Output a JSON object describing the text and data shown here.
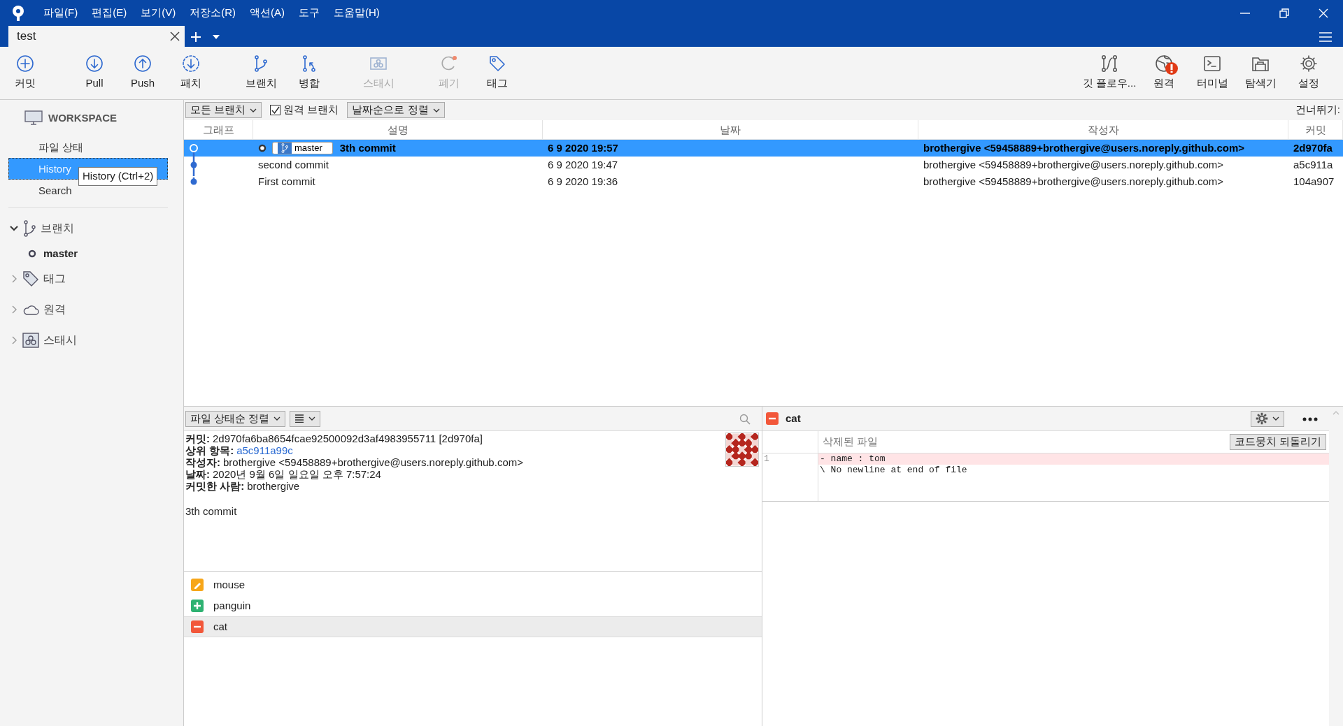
{
  "menu": [
    "파일(F)",
    "편집(E)",
    "보기(V)",
    "저장소(R)",
    "액션(A)",
    "도구",
    "도움말(H)"
  ],
  "tabs": [
    {
      "label": "test",
      "selected": true
    }
  ],
  "toolbar": {
    "left": [
      {
        "label": "커밋",
        "disabled": false
      },
      {
        "label": "Pull",
        "disabled": false
      },
      {
        "label": "Push",
        "disabled": false
      },
      {
        "label": "패치",
        "disabled": false
      },
      {
        "label": "브랜치",
        "disabled": false
      },
      {
        "label": "병합",
        "disabled": false
      },
      {
        "label": "스태시",
        "disabled": true
      },
      {
        "label": "폐기",
        "disabled": true
      },
      {
        "label": "태그",
        "disabled": false
      }
    ],
    "right": [
      {
        "label": "깃 플로우...",
        "alert": false
      },
      {
        "label": "원격",
        "alert": true
      },
      {
        "label": "터미널",
        "alert": false
      },
      {
        "label": "탐색기",
        "alert": false
      },
      {
        "label": "설정",
        "alert": false
      }
    ]
  },
  "sidebar": {
    "workspace": {
      "title": "WORKSPACE",
      "items": [
        {
          "label": "파일 상태",
          "selected": false
        },
        {
          "label": "History",
          "selected": true
        },
        {
          "label": "Search",
          "selected": false
        }
      ]
    },
    "tooltip": "History (Ctrl+2)",
    "groups": [
      {
        "label": "브랜치",
        "expanded": true,
        "children": [
          {
            "label": "master",
            "current": true
          }
        ]
      },
      {
        "label": "태그",
        "expanded": false
      },
      {
        "label": "원격",
        "expanded": false
      },
      {
        "label": "스태시",
        "expanded": false
      }
    ]
  },
  "filter_bar": {
    "branch_filter": "모든 브랜치",
    "remote_branches": {
      "label": "원격 브랜치",
      "checked": true
    },
    "sort": "날짜순으로 정렬",
    "jump_label": "건너뛰기:"
  },
  "commits": {
    "columns": [
      "그래프",
      "설명",
      "날짜",
      "작성자",
      "커밋"
    ],
    "rows": [
      {
        "description": "3th commit",
        "branch": "master",
        "date": "6 9 2020 19:57",
        "author": "brothergive <59458889+brothergive@users.noreply.github.com>",
        "commit": "2d970fa",
        "selected": true,
        "head": true
      },
      {
        "description": "second commit",
        "date": "6 9 2020 19:47",
        "author": "brothergive <59458889+brothergive@users.noreply.github.com>",
        "commit": "a5c911a",
        "selected": false,
        "head": false
      },
      {
        "description": "First commit",
        "date": "6 9 2020 19:36",
        "author": "brothergive <59458889+brothergive@users.noreply.github.com>",
        "commit": "104a907",
        "selected": false,
        "head": false
      }
    ]
  },
  "details": {
    "sort": "파일 상태순 정렬",
    "fields": [
      {
        "label": "커밋:",
        "value": "2d970fa6ba8654fcae92500092d3af4983955711 [2d970fa]",
        "link": false
      },
      {
        "label": "상위 항목:",
        "value": "a5c911a99c",
        "link": true
      },
      {
        "label": "작성자:",
        "value": "brothergive <59458889+brothergive@users.noreply.github.com>",
        "link": false
      },
      {
        "label": "날짜:",
        "value": "2020년 9월 6일 일요일 오후 7:57:24",
        "link": false
      },
      {
        "label": "커밋한 사람:",
        "value": "brothergive",
        "link": false
      }
    ],
    "message": "3th commit"
  },
  "files": [
    {
      "name": "mouse",
      "kind": "modified",
      "selected": false
    },
    {
      "name": "panguin",
      "kind": "added",
      "selected": false
    },
    {
      "name": "cat",
      "kind": "removed",
      "selected": true
    }
  ],
  "diff": {
    "file": "cat",
    "kind": "removed",
    "hunk_title": "삭제된 파일",
    "revert_button": "코드뭉치 되돌리기",
    "lines": [
      {
        "number": "1",
        "text": "- name : tom",
        "kind": "removed"
      },
      {
        "text": "\\ No newline at end of file",
        "kind": "note"
      }
    ]
  }
}
